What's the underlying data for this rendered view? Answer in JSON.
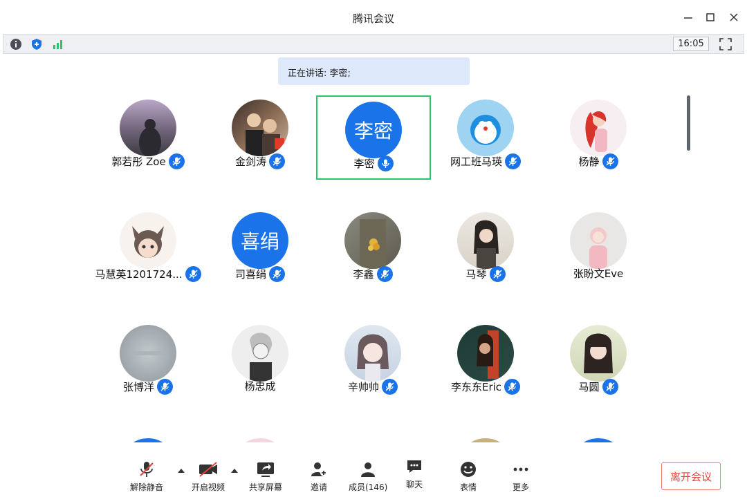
{
  "window": {
    "title": "腾讯会议"
  },
  "statusbar": {
    "time": "16:05"
  },
  "speaking": {
    "text": "正在讲话: 李密;"
  },
  "participants": [
    {
      "name": "郭若彤 Zoe",
      "avatar_text": "",
      "muted": true
    },
    {
      "name": "金剑涛",
      "avatar_text": "",
      "muted": true
    },
    {
      "name": "李密",
      "avatar_text": "李密",
      "muted": false,
      "speaking": true
    },
    {
      "name": "网工班马瑛",
      "avatar_text": "",
      "muted": true
    },
    {
      "name": "杨静",
      "avatar_text": "",
      "muted": true
    },
    {
      "name": "马慧英1201724...",
      "avatar_text": "",
      "muted": true
    },
    {
      "name": "司喜绢",
      "avatar_text": "喜绢",
      "muted": true
    },
    {
      "name": "李鑫",
      "avatar_text": "",
      "muted": true
    },
    {
      "name": "马琴",
      "avatar_text": "",
      "muted": true
    },
    {
      "name": "张盼文Eve",
      "avatar_text": "",
      "muted": false
    },
    {
      "name": "张博洋",
      "avatar_text": "",
      "muted": true
    },
    {
      "name": "杨忠成",
      "avatar_text": "",
      "muted": false
    },
    {
      "name": "辛帅帅",
      "avatar_text": "",
      "muted": true
    },
    {
      "name": "李东东Eric",
      "avatar_text": "",
      "muted": true
    },
    {
      "name": "马圆",
      "avatar_text": "",
      "muted": true
    }
  ],
  "toolbar": {
    "unmute": "解除静音",
    "video": "开启视频",
    "share": "共享屏幕",
    "invite": "邀请",
    "members": "成员(146)",
    "chat": "聊天",
    "reactions": "表情",
    "more": "更多",
    "leave": "离开会议"
  },
  "colors": {
    "accent": "#1a73e8",
    "speaking_border": "#2bc56b",
    "leave_red": "#e8413c"
  }
}
